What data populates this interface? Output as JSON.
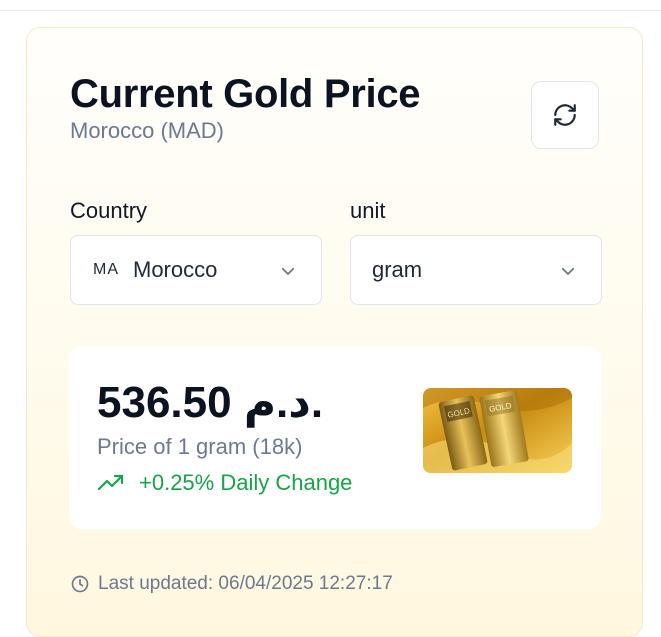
{
  "header": {
    "title": "Current Gold Price",
    "subtitle": "Morocco (MAD)",
    "refresh_icon": "refresh-icon"
  },
  "filters": {
    "country_label": "Country",
    "country_code": "MA",
    "country_value": "Morocco",
    "unit_label": "unit",
    "unit_value": "gram",
    "chevron_icon": "chevron-down-icon"
  },
  "price": {
    "value": "536.50 د.م.",
    "description": "Price of 1 gram (18k)",
    "change": "+0.25% Daily Change",
    "change_icon": "trending-up-icon",
    "change_color": "#16a34a",
    "image": "gold-bars"
  },
  "footer": {
    "last_updated": "Last updated: 06/04/2025 12:27:17",
    "clock_icon": "clock-icon"
  }
}
